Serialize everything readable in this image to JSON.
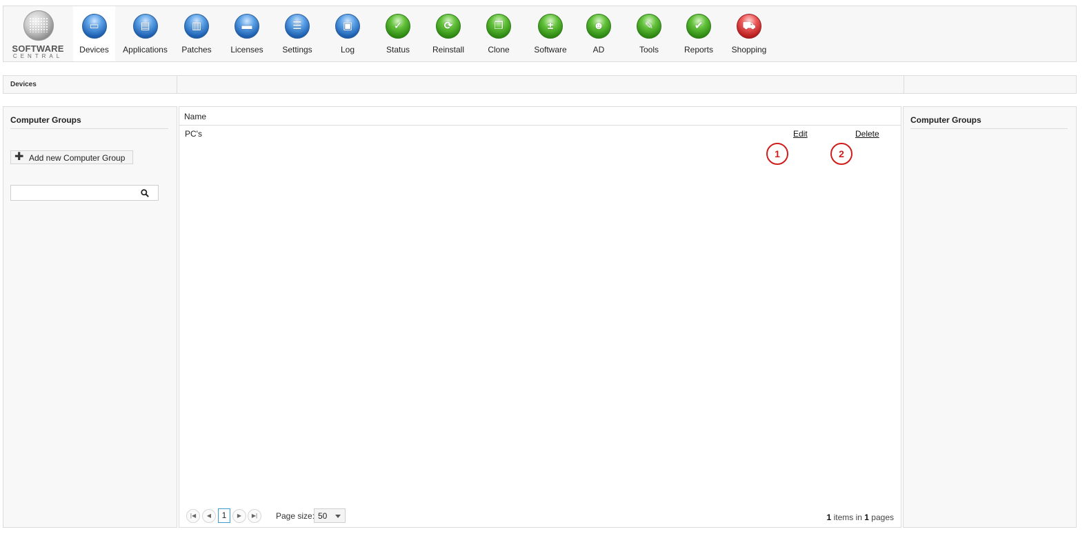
{
  "brand": {
    "line1": "SOFTWARE",
    "line2": "CENTRAL"
  },
  "nav": [
    {
      "label": "Devices",
      "icon": "monitor-icon",
      "color": "blue",
      "glyph": "▭",
      "active": true
    },
    {
      "label": "Applications",
      "icon": "applications-icon",
      "color": "blue",
      "glyph": "▤",
      "active": false
    },
    {
      "label": "Patches",
      "icon": "book-icon",
      "color": "blue",
      "glyph": "▥",
      "active": false
    },
    {
      "label": "Licenses",
      "icon": "folder-icon",
      "color": "blue",
      "glyph": "▬",
      "active": false
    },
    {
      "label": "Settings",
      "icon": "checklist-icon",
      "color": "blue",
      "glyph": "☰",
      "active": false
    },
    {
      "label": "Log",
      "icon": "logbook-icon",
      "color": "blue",
      "glyph": "▣",
      "active": false
    },
    {
      "label": "Status",
      "icon": "checkmark-icon",
      "color": "green",
      "glyph": "✓",
      "active": false
    },
    {
      "label": "Reinstall",
      "icon": "refresh-icon",
      "color": "green",
      "glyph": "⟳",
      "active": false
    },
    {
      "label": "Clone",
      "icon": "copy-icon",
      "color": "green",
      "glyph": "❐",
      "active": false
    },
    {
      "label": "Software",
      "icon": "plus-minus-icon",
      "color": "green",
      "glyph": "±",
      "active": false
    },
    {
      "label": "AD",
      "icon": "users-icon",
      "color": "green",
      "glyph": "☻",
      "active": false
    },
    {
      "label": "Tools",
      "icon": "wrench-icon",
      "color": "green",
      "glyph": "✎",
      "active": false
    },
    {
      "label": "Reports",
      "icon": "clipboard-check-icon",
      "color": "green",
      "glyph": "✔",
      "active": false
    },
    {
      "label": "Shopping",
      "icon": "cart-icon",
      "color": "red",
      "glyph": "⛟",
      "active": false
    }
  ],
  "breadcrumb": {
    "current": "Devices"
  },
  "left_panel": {
    "title": "Computer Groups",
    "add_button": "Add new Computer Group",
    "search": {
      "value": "",
      "placeholder": ""
    }
  },
  "grid": {
    "columns": [
      "Name"
    ],
    "rows": [
      {
        "name": "PC's",
        "edit": "Edit",
        "delete": "Delete"
      }
    ],
    "callouts": [
      "1",
      "2"
    ]
  },
  "pager": {
    "current_page": "1",
    "page_size_label": "Page size:",
    "page_size": "50",
    "items": "1",
    "items_text": "items in",
    "pages": "1",
    "pages_text": "pages"
  },
  "right_panel": {
    "title": "Computer Groups"
  }
}
